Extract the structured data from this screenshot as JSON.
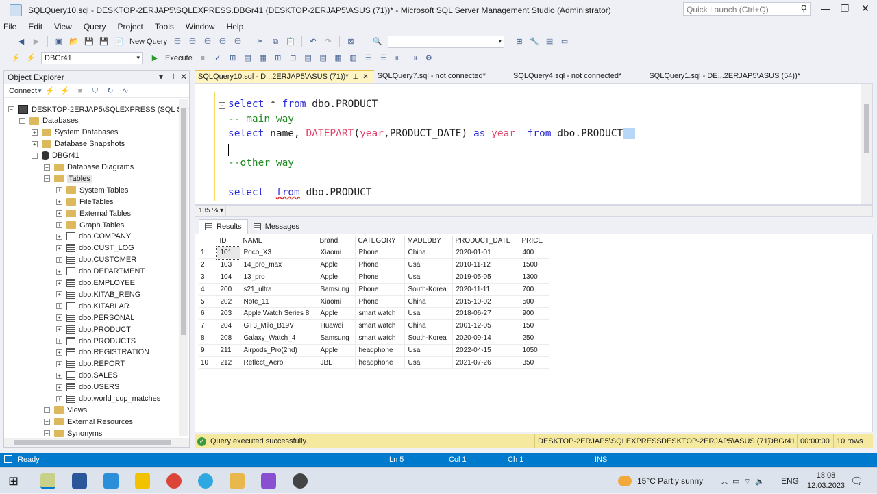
{
  "window": {
    "title": "SQLQuery10.sql - DESKTOP-2ERJAP5\\SQLEXPRESS.DBGr41 (DESKTOP-2ERJAP5\\ASUS (71))* - Microsoft SQL Server Management Studio (Administrator)",
    "quick_launch_placeholder": "Quick Launch (Ctrl+Q)"
  },
  "menu": [
    "File",
    "Edit",
    "View",
    "Query",
    "Project",
    "Tools",
    "Window",
    "Help"
  ],
  "toolbar": {
    "new_query": "New Query",
    "database": "DBGr41",
    "execute": "Execute"
  },
  "object_explorer": {
    "title": "Object Explorer",
    "connect": "Connect",
    "nodes": [
      {
        "label": "DESKTOP-2ERJAP5\\SQLEXPRESS (SQL Serve",
        "icon": "server-icon",
        "expand": "−"
      },
      {
        "label": "Databases",
        "icon": "folder-icon",
        "expand": "−"
      },
      {
        "label": "System Databases",
        "icon": "folder-icon",
        "expand": "+"
      },
      {
        "label": "Database Snapshots",
        "icon": "folder-icon",
        "expand": "+"
      },
      {
        "label": "DBGr41",
        "icon": "database-icon",
        "expand": "−"
      },
      {
        "label": "Database Diagrams",
        "icon": "folder-icon",
        "expand": "+"
      },
      {
        "label": "Tables",
        "icon": "folder-icon",
        "expand": "−"
      },
      {
        "label": "System Tables",
        "icon": "folder-icon",
        "expand": "+"
      },
      {
        "label": "FileTables",
        "icon": "folder-icon",
        "expand": "+"
      },
      {
        "label": "External Tables",
        "icon": "folder-icon",
        "expand": "+"
      },
      {
        "label": "Graph Tables",
        "icon": "folder-icon",
        "expand": "+"
      },
      {
        "label": "dbo.COMPANY",
        "icon": "table-icon",
        "expand": "+"
      },
      {
        "label": "dbo.CUST_LOG",
        "icon": "table-icon",
        "expand": "+"
      },
      {
        "label": "dbo.CUSTOMER",
        "icon": "table-icon",
        "expand": "+"
      },
      {
        "label": "dbo.DEPARTMENT",
        "icon": "table-icon",
        "expand": "+"
      },
      {
        "label": "dbo.EMPLOYEE",
        "icon": "table-icon",
        "expand": "+"
      },
      {
        "label": "dbo.KITAB_RENG",
        "icon": "table-icon",
        "expand": "+"
      },
      {
        "label": "dbo.KITABLAR",
        "icon": "table-icon",
        "expand": "+"
      },
      {
        "label": "dbo.PERSONAL",
        "icon": "table-icon",
        "expand": "+"
      },
      {
        "label": "dbo.PRODUCT",
        "icon": "table-icon",
        "expand": "+"
      },
      {
        "label": "dbo.PRODUCTS",
        "icon": "table-icon",
        "expand": "+"
      },
      {
        "label": "dbo.REGISTRATION",
        "icon": "table-icon",
        "expand": "+"
      },
      {
        "label": "dbo.REPORT",
        "icon": "table-icon",
        "expand": "+"
      },
      {
        "label": "dbo.SALES",
        "icon": "table-icon",
        "expand": "+"
      },
      {
        "label": "dbo.USERS",
        "icon": "table-icon",
        "expand": "+"
      },
      {
        "label": "dbo.world_cup_matches",
        "icon": "table-icon",
        "expand": "+"
      },
      {
        "label": "Views",
        "icon": "folder-icon",
        "expand": "+"
      },
      {
        "label": "External Resources",
        "icon": "folder-icon",
        "expand": "+"
      },
      {
        "label": "Synonyms",
        "icon": "folder-icon",
        "expand": "+"
      }
    ]
  },
  "tabs": [
    {
      "label": "SQLQuery10.sql - D...2ERJAP5\\ASUS (71))*",
      "active": true
    },
    {
      "label": "SQLQuery7.sql - not connected*",
      "active": false
    },
    {
      "label": "SQLQuery4.sql - not connected*",
      "active": false
    },
    {
      "label": "SQLQuery1.sql - DE...2ERJAP5\\ASUS (54))*",
      "active": false
    }
  ],
  "editor": {
    "zoom": "135 %",
    "line1": {
      "k1": "select",
      "p1": " * ",
      "k2": "from",
      "p2": " dbo.PRODUCT"
    },
    "line2": "-- main way",
    "line3": {
      "k1": "select",
      "p1": " name, ",
      "f1": "DATEPART",
      "p2": "(",
      "f2": "year",
      "p3": ",PRODUCT_DATE) ",
      "k2": "as",
      "p4": " ",
      "f3": "year",
      "p5": "  ",
      "k3": "from",
      "p6": " dbo.PRODUCT"
    },
    "line5": "--other way",
    "line7": {
      "k1": "select",
      "p1": "  ",
      "k2": "from",
      "p2": " dbo.PRODUCT"
    }
  },
  "results": {
    "tab_results": "Results",
    "tab_messages": "Messages",
    "columns": [
      "ID",
      "NAME",
      "Brand",
      "CATEGORY",
      "MADEDBY",
      "PRODUCT_DATE",
      "PRICE"
    ],
    "rows": [
      [
        "1",
        "101",
        "Poco_X3",
        "Xiaomi",
        "Phone",
        "China",
        "2020-01-01",
        "400"
      ],
      [
        "2",
        "103",
        "14_pro_max",
        "Apple",
        "Phone",
        "Usa",
        "2010-11-12",
        "1500"
      ],
      [
        "3",
        "104",
        "13_pro",
        "Apple",
        "Phone",
        "Usa",
        "2019-05-05",
        "1300"
      ],
      [
        "4",
        "200",
        "s21_ultra",
        "Samsung",
        "Phone",
        "South-Korea",
        "2020-11-11",
        "700"
      ],
      [
        "5",
        "202",
        "Note_11",
        "Xiaomi",
        "Phone",
        "China",
        "2015-10-02",
        "500"
      ],
      [
        "6",
        "203",
        "Apple Watch Series 8",
        "Apple",
        "smart watch",
        "Usa",
        "2018-06-27",
        "900"
      ],
      [
        "7",
        "204",
        "GT3_Milo_B19V",
        "Huawei",
        "smart watch",
        "China",
        "2001-12-05",
        "150"
      ],
      [
        "8",
        "208",
        "Galaxy_Watch_4",
        "Samsung",
        "smart watch",
        "South-Korea",
        "2020-09-14",
        "250"
      ],
      [
        "9",
        "211",
        "Airpods_Pro(2nd)",
        "Apple",
        "headphone",
        "Usa",
        "2022-04-15",
        "1050"
      ],
      [
        "10",
        "212",
        "Reflect_Aero",
        "JBL",
        "headphone",
        "Usa",
        "2021-07-26",
        "350"
      ]
    ]
  },
  "query_status": {
    "message": "Query executed successfully.",
    "server": "DESKTOP-2ERJAP5\\SQLEXPRESS ...",
    "user": "DESKTOP-2ERJAP5\\ASUS (71)",
    "db": "DBGr41",
    "time": "00:00:00",
    "rows": "10 rows"
  },
  "statusbar": {
    "ready": "Ready",
    "ln": "Ln 5",
    "col": "Col 1",
    "ch": "Ch 1",
    "ins": "INS"
  },
  "taskbar": {
    "weather": "15°C  Partly sunny",
    "lang": "ENG",
    "time": "18:08",
    "date": "12.03.2023"
  },
  "colors": {
    "accent": "#007acc",
    "active_tab": "#fff5c4",
    "status_strip": "#f5e9a0",
    "keyword": "#2c2cd6",
    "function": "#e0446b",
    "comment": "#208b20"
  }
}
